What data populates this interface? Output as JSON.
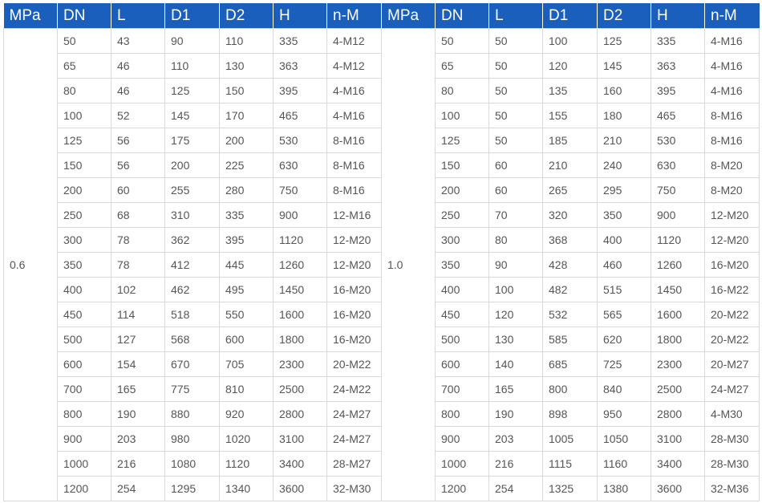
{
  "headers": [
    "MPa",
    "DN",
    "L",
    "D1",
    "D2",
    "H",
    "n-M",
    "MPa",
    "DN",
    "L",
    "D1",
    "D2",
    "H",
    "n-M"
  ],
  "left_pressure": "0.6",
  "right_pressure": "1.0",
  "rows": [
    [
      [
        "50",
        "43",
        "90",
        "110",
        "335",
        "4-M12"
      ],
      [
        "50",
        "50",
        "100",
        "125",
        "335",
        "4-M16"
      ]
    ],
    [
      [
        "65",
        "46",
        "110",
        "130",
        "363",
        "4-M12"
      ],
      [
        "65",
        "50",
        "120",
        "145",
        "363",
        "4-M16"
      ]
    ],
    [
      [
        "80",
        "46",
        "125",
        "150",
        "395",
        "4-M16"
      ],
      [
        "80",
        "50",
        "135",
        "160",
        "395",
        "4-M16"
      ]
    ],
    [
      [
        "100",
        "52",
        "145",
        "170",
        "465",
        "4-M16"
      ],
      [
        "100",
        "50",
        "155",
        "180",
        "465",
        "8-M16"
      ]
    ],
    [
      [
        "125",
        "56",
        "175",
        "200",
        "530",
        "8-M16"
      ],
      [
        "125",
        "50",
        "185",
        "210",
        "530",
        "8-M16"
      ]
    ],
    [
      [
        "150",
        "56",
        "200",
        "225",
        "630",
        "8-M16"
      ],
      [
        "150",
        "60",
        "210",
        "240",
        "630",
        "8-M20"
      ]
    ],
    [
      [
        "200",
        "60",
        "255",
        "280",
        "750",
        "8-M16"
      ],
      [
        "200",
        "60",
        "265",
        "295",
        "750",
        "8-M20"
      ]
    ],
    [
      [
        "250",
        "68",
        "310",
        "335",
        "900",
        "12-M16"
      ],
      [
        "250",
        "70",
        "320",
        "350",
        "900",
        "12-M20"
      ]
    ],
    [
      [
        "300",
        "78",
        "362",
        "395",
        "1120",
        "12-M20"
      ],
      [
        "300",
        "80",
        "368",
        "400",
        "1120",
        "12-M20"
      ]
    ],
    [
      [
        "350",
        "78",
        "412",
        "445",
        "1260",
        "12-M20"
      ],
      [
        "350",
        "90",
        "428",
        "460",
        "1260",
        "16-M20"
      ]
    ],
    [
      [
        "400",
        "102",
        "462",
        "495",
        "1450",
        "16-M20"
      ],
      [
        "400",
        "100",
        "482",
        "515",
        "1450",
        "16-M22"
      ]
    ],
    [
      [
        "450",
        "114",
        "518",
        "550",
        "1600",
        "16-M20"
      ],
      [
        "450",
        "120",
        "532",
        "565",
        "1600",
        "20-M22"
      ]
    ],
    [
      [
        "500",
        "127",
        "568",
        "600",
        "1800",
        "16-M20"
      ],
      [
        "500",
        "130",
        "585",
        "620",
        "1800",
        "20-M22"
      ]
    ],
    [
      [
        "600",
        "154",
        "670",
        "705",
        "2300",
        "20-M22"
      ],
      [
        "600",
        "140",
        "685",
        "725",
        "2300",
        "20-M27"
      ]
    ],
    [
      [
        "700",
        "165",
        "775",
        "810",
        "2500",
        "24-M22"
      ],
      [
        "700",
        "165",
        "800",
        "840",
        "2500",
        "24-M27"
      ]
    ],
    [
      [
        "800",
        "190",
        "880",
        "920",
        "2800",
        "24-M27"
      ],
      [
        "800",
        "190",
        "898",
        "950",
        "2800",
        "4-M30"
      ]
    ],
    [
      [
        "900",
        "203",
        "980",
        "1020",
        "3100",
        "24-M27"
      ],
      [
        "900",
        "203",
        "1005",
        "1050",
        "3100",
        "28-M30"
      ]
    ],
    [
      [
        "1000",
        "216",
        "1080",
        "1120",
        "3400",
        "28-M27"
      ],
      [
        "1000",
        "216",
        "1115",
        "1160",
        "3400",
        "28-M30"
      ]
    ],
    [
      [
        "1200",
        "254",
        "1295",
        "1340",
        "3600",
        "32-M30"
      ],
      [
        "1200",
        "254",
        "1325",
        "1380",
        "3600",
        "32-M36"
      ]
    ]
  ],
  "colors": {
    "header_bg": "#1a5fbb",
    "header_text": "#ffffff",
    "cell_text": "#555555",
    "grid": "#d9d9d9"
  }
}
